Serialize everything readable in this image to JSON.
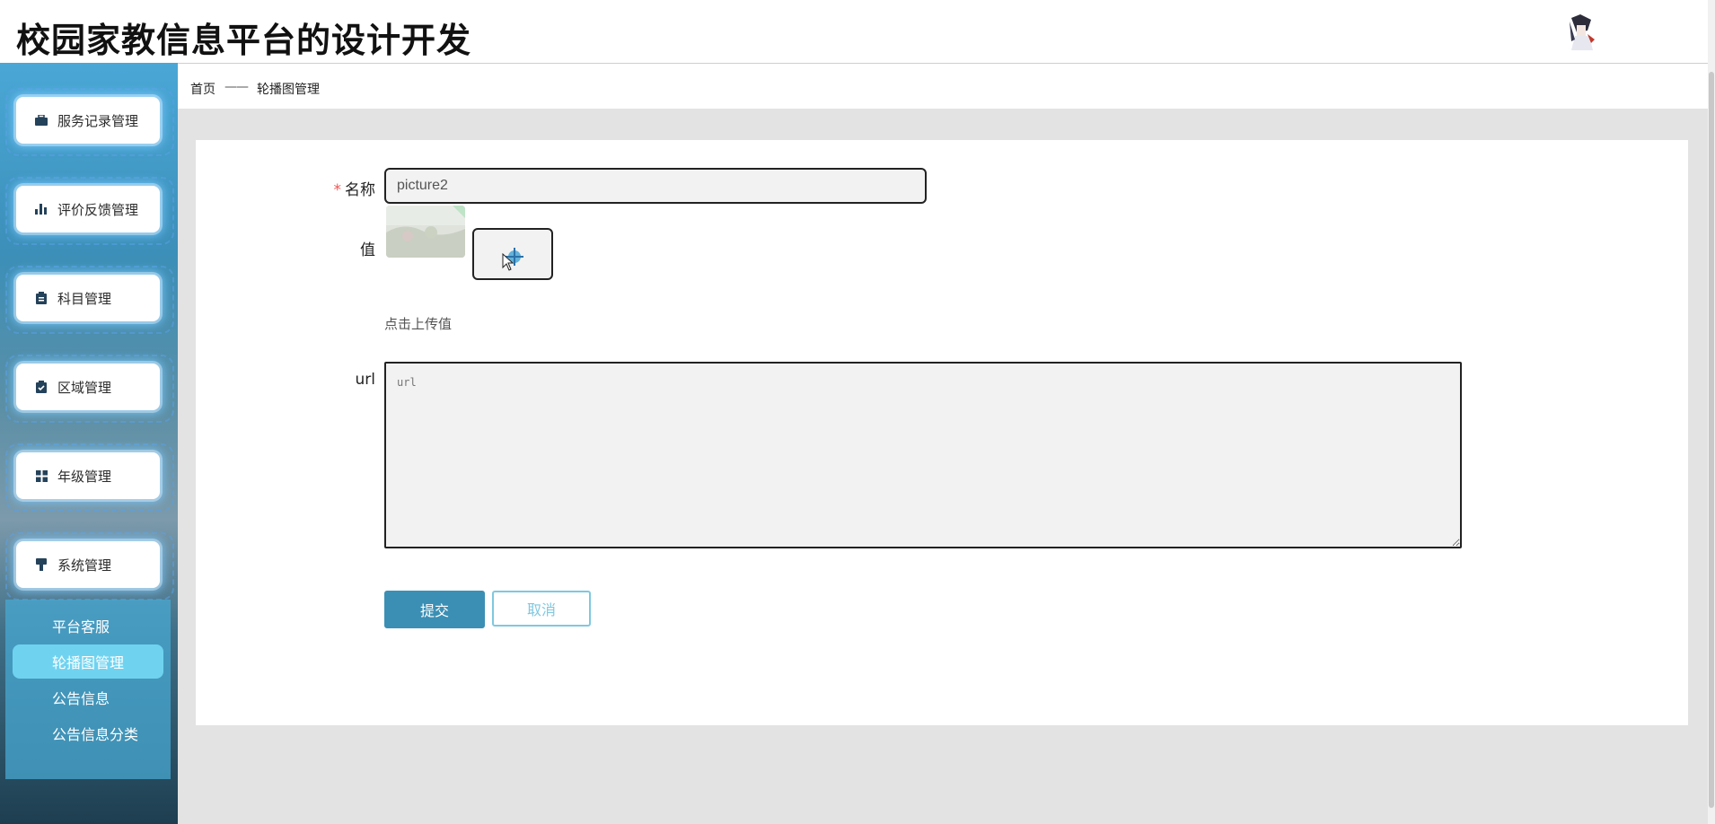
{
  "header": {
    "title": "校园家教信息平台的设计开发",
    "avatar_icon": "user-avatar"
  },
  "sidebar": {
    "menus": [
      {
        "label": "服务记录管理",
        "icon": "briefcase-icon"
      },
      {
        "label": "评价反馈管理",
        "icon": "bar-chart-icon"
      },
      {
        "label": "科目管理",
        "icon": "clipboard-icon"
      },
      {
        "label": "区域管理",
        "icon": "clipboard-check-icon"
      },
      {
        "label": "年级管理",
        "icon": "grid-icon"
      },
      {
        "label": "系统管理",
        "icon": "brush-icon"
      }
    ],
    "submenu": [
      {
        "label": "平台客服",
        "active": false
      },
      {
        "label": "轮播图管理",
        "active": true
      },
      {
        "label": "公告信息",
        "active": false
      },
      {
        "label": "公告信息分类",
        "active": false
      }
    ]
  },
  "breadcrumb": {
    "home": "首页",
    "separator": "——",
    "current": "轮播图管理"
  },
  "form": {
    "name_required_mark": "*",
    "name_label": "名称",
    "name_value": "picture2",
    "value_label": "值",
    "upload_hint": "点击上传值",
    "url_label": "url",
    "url_placeholder": "url",
    "url_value": "",
    "submit_label": "提交",
    "cancel_label": "取消"
  },
  "colors": {
    "accent": "#3b8fb4",
    "cancel_border": "#7fc8e0",
    "active_submenu": "#6fd3f0"
  }
}
